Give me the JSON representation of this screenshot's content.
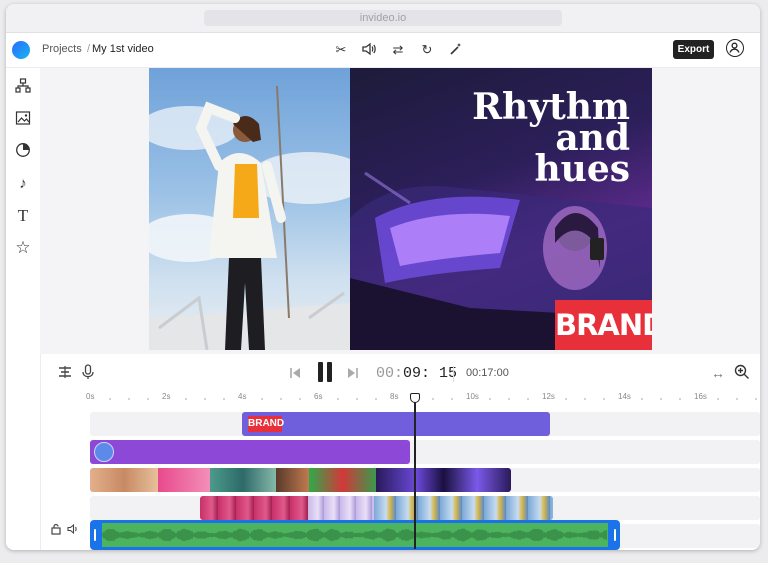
{
  "browser": {
    "url": "invideo.io"
  },
  "header": {
    "breadcrumb": {
      "projects": "Projects",
      "separator": "/",
      "current": "My 1st video"
    },
    "tools": [
      {
        "name": "scissors-icon",
        "glyph": "✂"
      },
      {
        "name": "volume-icon",
        "glyph": "🔈"
      },
      {
        "name": "swap-icon",
        "glyph": "⇄"
      },
      {
        "name": "rotate-icon",
        "glyph": "↻"
      },
      {
        "name": "magic-wand-icon",
        "glyph": "✨"
      }
    ],
    "export_label": "Export"
  },
  "sidebar": {
    "items": [
      {
        "name": "layouts-icon",
        "glyph": "⊞"
      },
      {
        "name": "media-icon",
        "glyph": "▣"
      },
      {
        "name": "stickers-icon",
        "glyph": "◔"
      },
      {
        "name": "music-icon",
        "glyph": "♪"
      },
      {
        "name": "text-icon",
        "glyph": "T"
      },
      {
        "name": "favorites-icon",
        "glyph": "☆"
      }
    ]
  },
  "canvas": {
    "headline_line1": "Rhythm",
    "headline_line2": "and",
    "headline_line3": "hues",
    "brand_text": "BRAND"
  },
  "playback": {
    "current_prefix": "00:",
    "current_main": "09: 15",
    "duration": "00:17:00"
  },
  "timeline": {
    "ruler": [
      "0s",
      "2s",
      "4s",
      "6s",
      "8s",
      "10s",
      "12s",
      "14s",
      "16s"
    ],
    "brand_clip_label": "BRAND",
    "playhead_time_s": 8.6
  },
  "colors": {
    "accent": "#1a73e8",
    "text_track": "#7b5bd6",
    "sticker_track": "#8e48d8",
    "audio_track": "#4cb35e",
    "brand_red": "#e8303a"
  }
}
